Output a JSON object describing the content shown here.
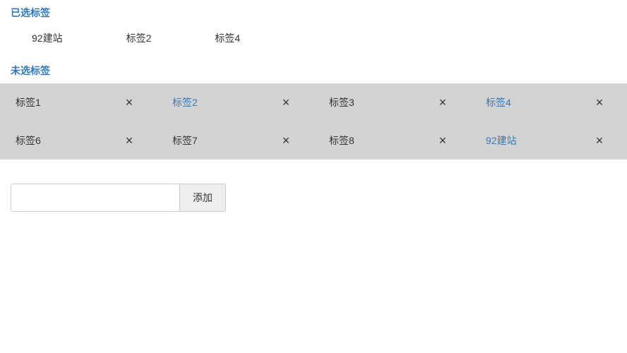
{
  "headers": {
    "selected": "已选标签",
    "unselected": "未选标签"
  },
  "selected_tags": [
    "92建站",
    "标签2",
    "标签4"
  ],
  "unselected_tags": [
    {
      "label": "标签1",
      "active": false
    },
    {
      "label": "标签2",
      "active": true
    },
    {
      "label": "标签3",
      "active": false
    },
    {
      "label": "标签4",
      "active": true
    },
    {
      "label": "标签6",
      "active": false
    },
    {
      "label": "标签7",
      "active": false
    },
    {
      "label": "标签8",
      "active": false
    },
    {
      "label": "92建站",
      "active": true
    }
  ],
  "add": {
    "button_label": "添加",
    "input_value": ""
  }
}
